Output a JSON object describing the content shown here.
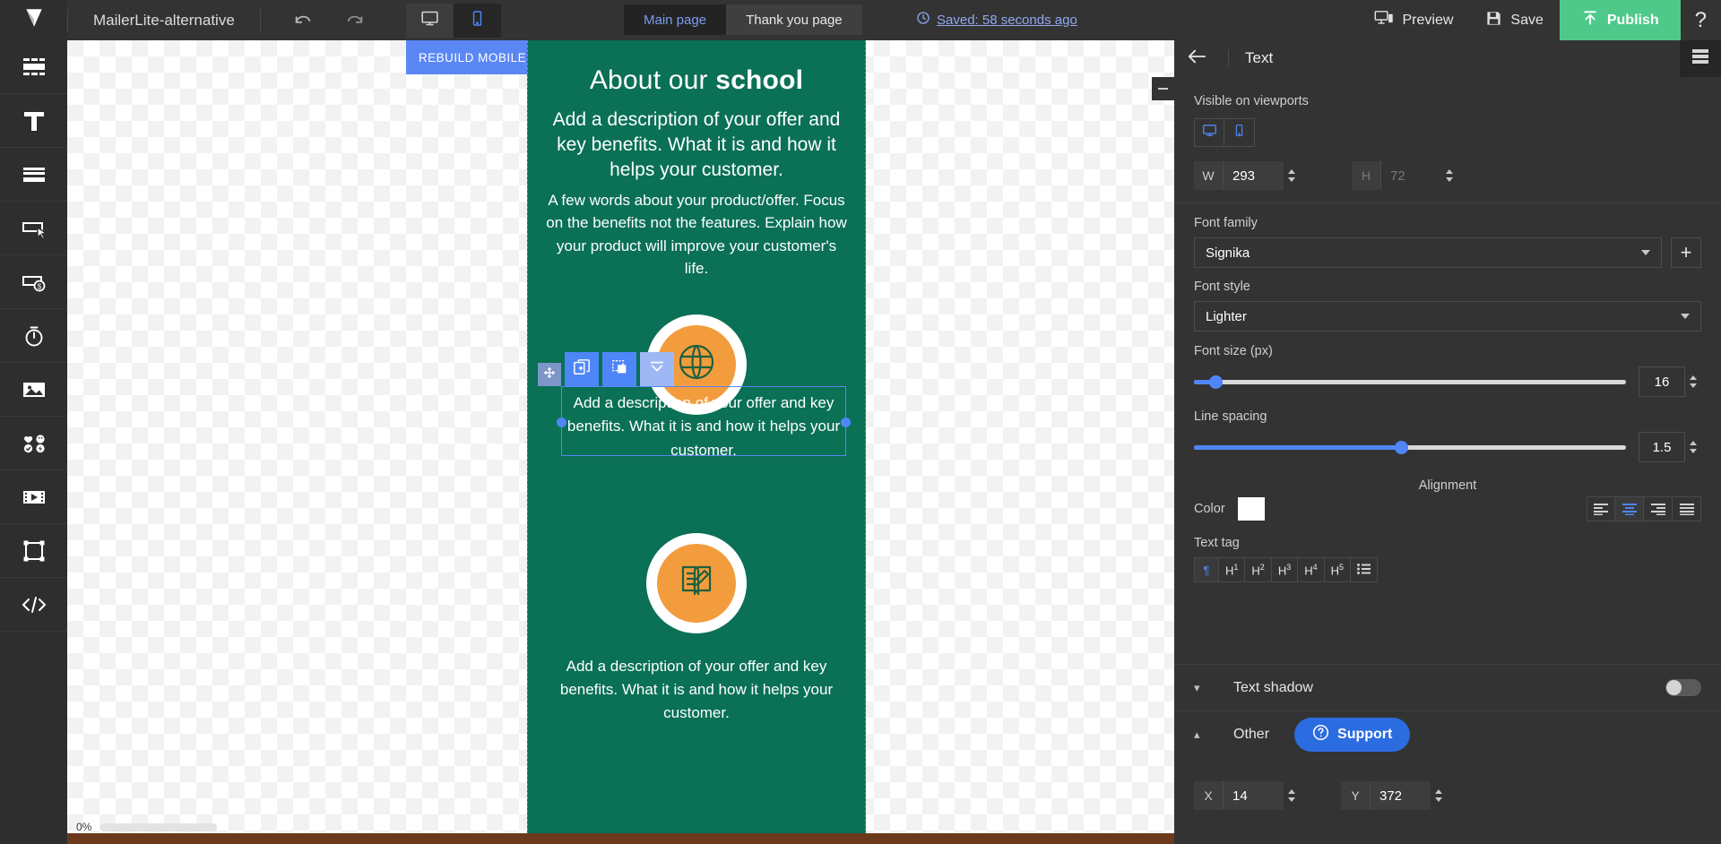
{
  "topbar": {
    "logo_icon": "landing-logo-icon",
    "project_name": "MailerLite-alternative",
    "undo_icon": "undo-icon",
    "redo_icon": "redo-icon",
    "desktop_icon": "desktop-viewport-icon",
    "mobile_icon": "mobile-viewport-icon",
    "tabs": [
      {
        "label": "Main page",
        "active": true
      },
      {
        "label": "Thank you page",
        "active": false
      }
    ],
    "saved_status": "Saved: 58 seconds ago",
    "saved_icon": "clock-history-icon",
    "preview_label": "Preview",
    "preview_icon": "preview-devices-icon",
    "save_label": "Save",
    "save_icon": "floppy-disk-icon",
    "publish_label": "Publish",
    "publish_icon": "upload-arrow-icon",
    "publish_color": "#4ec98a",
    "help_label": "?"
  },
  "sidebar": {
    "items": [
      {
        "name": "blocks",
        "icon": "blocks-icon"
      },
      {
        "name": "text",
        "icon": "text-t-icon"
      },
      {
        "name": "rows",
        "icon": "rows-icon"
      },
      {
        "name": "button",
        "icon": "button-cursor-icon"
      },
      {
        "name": "payment-button",
        "icon": "payment-button-icon"
      },
      {
        "name": "timer",
        "icon": "timer-stopwatch-icon"
      },
      {
        "name": "image",
        "icon": "image-picture-icon"
      },
      {
        "name": "icons",
        "icon": "icons-set-icon"
      },
      {
        "name": "video",
        "icon": "video-film-icon"
      },
      {
        "name": "shape",
        "icon": "shape-frame-icon"
      },
      {
        "name": "code",
        "icon": "code-brackets-icon"
      }
    ]
  },
  "canvas": {
    "rebuild_label": "REBUILD MOBILE",
    "rebuild_color": "#5b87f5",
    "page_bg_color": "#0a7056",
    "zoom_level": "0%",
    "collapse_icon": "panel-collapse-icon",
    "page_content": {
      "heading_plain": "About our ",
      "heading_bold": "school",
      "lead": "Add a description of your offer and key benefits. What it is and how it helps your customer.",
      "sub": "A few words about your product/offer. Focus on the benefits not the features. Explain how your product will improve your customer's life.",
      "badge1_icon": "globe-badge-icon",
      "block1_text": "Add a description of your offer and key benefits. What it is and how it helps your customer.",
      "badge2_icon": "book-pencil-badge-icon",
      "block2_text": "Add a description of your offer and key benefits. What it is and how it helps your customer."
    },
    "selection_toolbar": {
      "move_icon": "move-handle-icon",
      "duplicate_icon": "duplicate-add-icon",
      "copy_style_icon": "copy-style-icon",
      "collapse_icon": "collapse-down-icon"
    }
  },
  "rightpanel": {
    "back_icon": "back-arrow-icon",
    "title": "Text",
    "list_icon": "layers-list-icon",
    "viewports_label": "Visible on viewports",
    "viewport_desktop_icon": "desktop-viewport-icon",
    "viewport_mobile_icon": "mobile-viewport-icon",
    "w_label": "W",
    "w_value": "293",
    "h_label": "H",
    "h_value": "72",
    "font_family_label": "Font family",
    "font_family_value": "Signika",
    "add_font_label": "+",
    "font_style_label": "Font style",
    "font_style_value": "Lighter",
    "font_size_label": "Font size (px)",
    "font_size_value": "16",
    "font_size_pct": 5,
    "line_spacing_label": "Line spacing",
    "line_spacing_value": "1.5",
    "line_spacing_pct": 48,
    "alignment_label": "Alignment",
    "alignment_options": [
      "align-left",
      "align-center",
      "align-right",
      "align-justify"
    ],
    "alignment_selected": 1,
    "color_label": "Color",
    "color_value": "#ffffff",
    "text_tag_label": "Text tag",
    "text_tags": [
      "¶",
      "H1",
      "H2",
      "H3",
      "H4",
      "H5",
      "list"
    ],
    "text_tag_selected": 0,
    "text_shadow_label": "Text shadow",
    "text_shadow_on": false,
    "other_label": "Other",
    "support_label": "Support",
    "support_icon": "question-circle-icon",
    "x_label": "X",
    "x_value": "14",
    "y_label": "Y",
    "y_value": "372"
  }
}
